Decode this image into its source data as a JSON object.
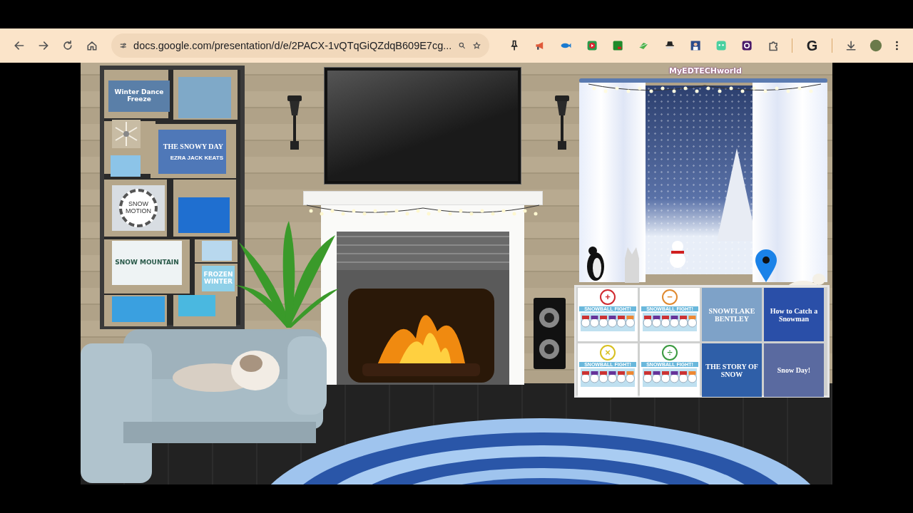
{
  "browser": {
    "url": "docs.google.com/presentation/d/e/2PACX-1vQTqGiQZdqB609E7cg...",
    "google_letter": "G"
  },
  "scene": {
    "logo": "MyEDTECHworld",
    "shelf_items": [
      {
        "kind": "card",
        "title": "Winter Dance Freeze",
        "color": "#5a7fa8"
      },
      {
        "kind": "picture",
        "color": "#7fa9c8"
      },
      {
        "kind": "snowflake",
        "color": "#c8bca4"
      },
      {
        "kind": "cover",
        "title": "THE SNOWY DAY",
        "subtitle": "EZRA JACK KEATS",
        "color": "#4f78b8"
      },
      {
        "kind": "picture",
        "color": "#8cc4e8"
      },
      {
        "kind": "badge",
        "title": "SNOW MOTION",
        "color": "#d8dde2"
      },
      {
        "kind": "picture",
        "color": "#1f6fd0"
      },
      {
        "kind": "card",
        "title": "SNOW MOUNTAIN",
        "color": "#eef3f4"
      },
      {
        "kind": "picture",
        "color": "#b8d8ee"
      },
      {
        "kind": "card",
        "title": "FROZEN WINTER",
        "color": "#8fd0e8"
      },
      {
        "kind": "picture",
        "color": "#3aa0e0"
      },
      {
        "kind": "picture",
        "color": "#4ab8e0"
      }
    ],
    "cubby_items": [
      {
        "kind": "game",
        "title": "SNOWBALL FIGHT!",
        "symbol": "+",
        "color": "#d02a30"
      },
      {
        "kind": "game",
        "title": "SNOWBALL FIGHT!",
        "symbol": "−",
        "color": "#e08a30"
      },
      {
        "kind": "book",
        "title": "SNOWFLAKE BENTLEY",
        "color": "#7ea2c8"
      },
      {
        "kind": "book",
        "title": "How to Catch a Snowman",
        "color": "#2a4fa8"
      },
      {
        "kind": "game",
        "title": "SNOWBALL FIGHT!",
        "symbol": "×",
        "color": "#d8c020"
      },
      {
        "kind": "game",
        "title": "SNOWBALL FIGHT!",
        "symbol": "÷",
        "color": "#3a9a40"
      },
      {
        "kind": "book",
        "title": "THE STORY OF SNOW",
        "color": "#2f5fa8"
      },
      {
        "kind": "book",
        "title": "Snow Day!",
        "color": "#5a6aa0"
      }
    ]
  }
}
